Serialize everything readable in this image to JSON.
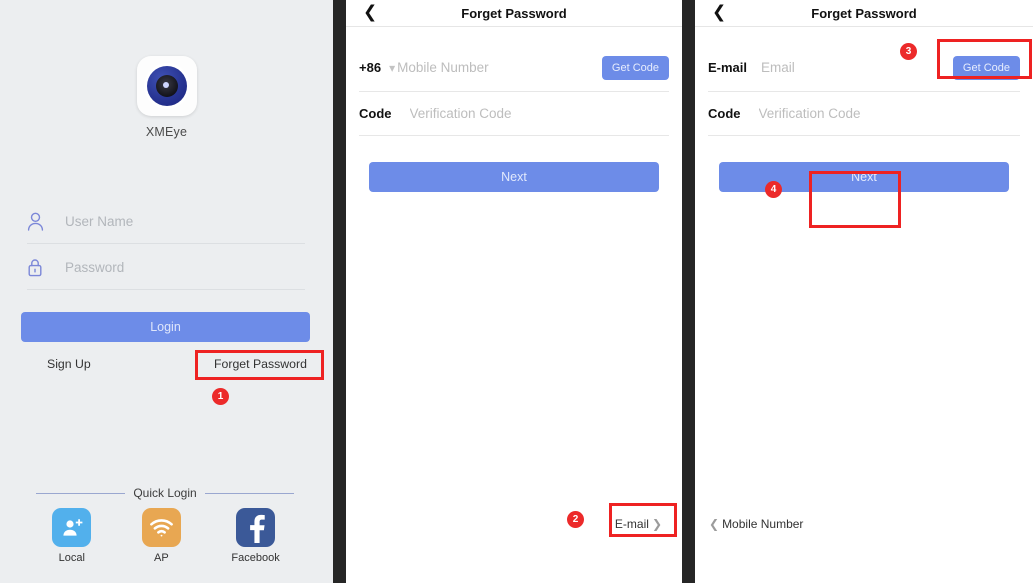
{
  "app": {
    "name": "XMEye",
    "logo_icon": "xmeye-eye-icon",
    "accent_blue": "#6d8ce8",
    "annotation_red": "#ec2a2a",
    "panel_bg": "#eceef0"
  },
  "login_panel": {
    "logo_label": "XMEye",
    "username_field": {
      "icon": "user-icon",
      "value": "",
      "placeholder": "User Name"
    },
    "password_field": {
      "icon": "lock-icon",
      "value": "",
      "placeholder": "Password"
    },
    "login_button": "Login",
    "signup_link": "Sign Up",
    "forget_password_link": "Forget Password",
    "quick_login": {
      "divider_label": "Quick Login",
      "items": [
        {
          "label": "Local",
          "icon": "local-user-add-icon",
          "color": "#52b0ec"
        },
        {
          "label": "AP",
          "icon": "wifi-icon",
          "color": "#e8a752"
        },
        {
          "label": "Facebook",
          "icon": "facebook-icon",
          "color": "#3b5998"
        }
      ]
    }
  },
  "mobile_panel": {
    "header": {
      "back_icon": "chevron-left-icon",
      "title": "Forget Password"
    },
    "mobile_row": {
      "country_code": "+86",
      "dropdown_icon": "chevron-down-icon",
      "value": "",
      "placeholder": "Mobile Number",
      "get_code_button": "Get Code"
    },
    "code_row": {
      "label": "Code",
      "value": "",
      "placeholder": "Verification Code"
    },
    "next_button": "Next",
    "switch_link": {
      "label": "E-mail",
      "icon": "chevron-right-icon"
    }
  },
  "email_panel": {
    "header": {
      "back_icon": "chevron-left-icon",
      "title": "Forget Password"
    },
    "email_row": {
      "label": "E-mail",
      "value": "",
      "placeholder": "Email",
      "get_code_button": "Get Code"
    },
    "code_row": {
      "label": "Code",
      "value": "",
      "placeholder": "Verification Code"
    },
    "next_button": "Next",
    "switch_link": {
      "label": "Mobile Number",
      "icon": "chevron-left-icon"
    }
  },
  "annotations": {
    "badges": [
      {
        "number": "1",
        "target": "forget-password-link"
      },
      {
        "number": "2",
        "target": "email-switch-link"
      },
      {
        "number": "3",
        "target": "email-get-code-button"
      },
      {
        "number": "4",
        "target": "email-next-button"
      }
    ]
  }
}
